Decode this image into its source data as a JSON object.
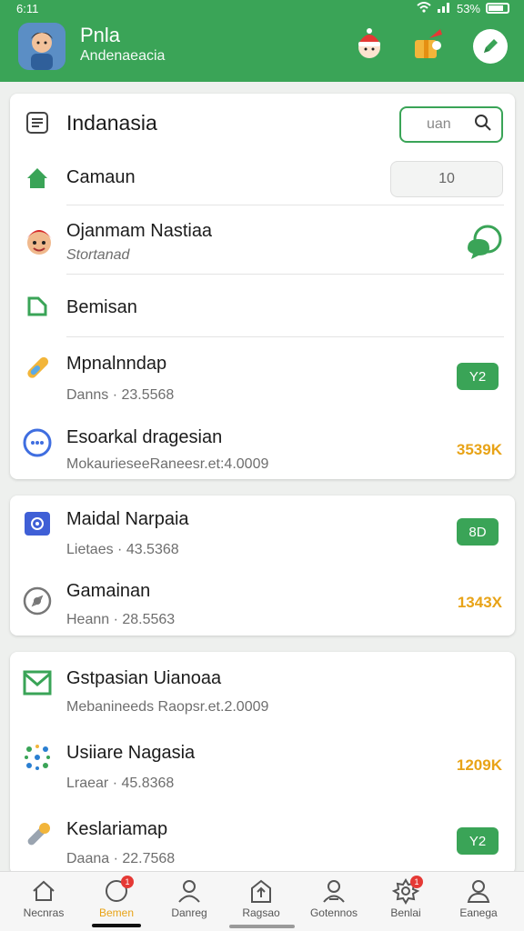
{
  "status": {
    "time": "6:11",
    "battery": "53%"
  },
  "header": {
    "title": "Pnla",
    "subtitle": "Andenaeacia"
  },
  "card1": {
    "title": "Indanasia",
    "search_placeholder": "uan",
    "home_label": "Camaun",
    "home_value": "10",
    "user_name": "Ojanmam Nastiaa",
    "user_sub": "Stortanad",
    "section_label": "Bemisan",
    "item1": {
      "title": "Mpnalnndap",
      "sub": "Danns · 23.5568",
      "badge": "Y2"
    },
    "item2": {
      "title": "Esoarkal dragesian",
      "sub": "MokaurieseeRaneesr.et:4.0009",
      "amount": "3539K"
    }
  },
  "card2": {
    "item1": {
      "title": "Maidal Narpaia",
      "sub": "Lietaes · 43.5368",
      "badge": "8D"
    },
    "item2": {
      "title": "Gamainan",
      "sub": "Heann · 28.5563",
      "amount": "1343X"
    }
  },
  "card3": {
    "item1": {
      "title": "Gstpasian Uianoaa",
      "sub": "Mebanineeds Raopsr.et.2.0009"
    },
    "item2": {
      "title": "Usiiare Nagasia",
      "sub": "Lraear · 45.8368",
      "amount": "1209K"
    },
    "item3": {
      "title": "Keslariamap",
      "sub": "Daana · 22.7568",
      "badge": "Y2"
    }
  },
  "nav": {
    "items": [
      {
        "label": "Necnras",
        "icon": "home-icon"
      },
      {
        "label": "Bemen",
        "icon": "chat-icon",
        "badge": "1"
      },
      {
        "label": "Danreg",
        "icon": "person-icon"
      },
      {
        "label": "Ragsao",
        "icon": "upload-icon"
      },
      {
        "label": "Gotennos",
        "icon": "group-icon"
      },
      {
        "label": "Benlai",
        "icon": "settings-icon",
        "badge": "1"
      },
      {
        "label": "Eanega",
        "icon": "profile-icon"
      }
    ],
    "active_index": 1
  },
  "colors": {
    "primary": "#3aa457",
    "amount": "#e8a317",
    "badge": "#e53935"
  }
}
